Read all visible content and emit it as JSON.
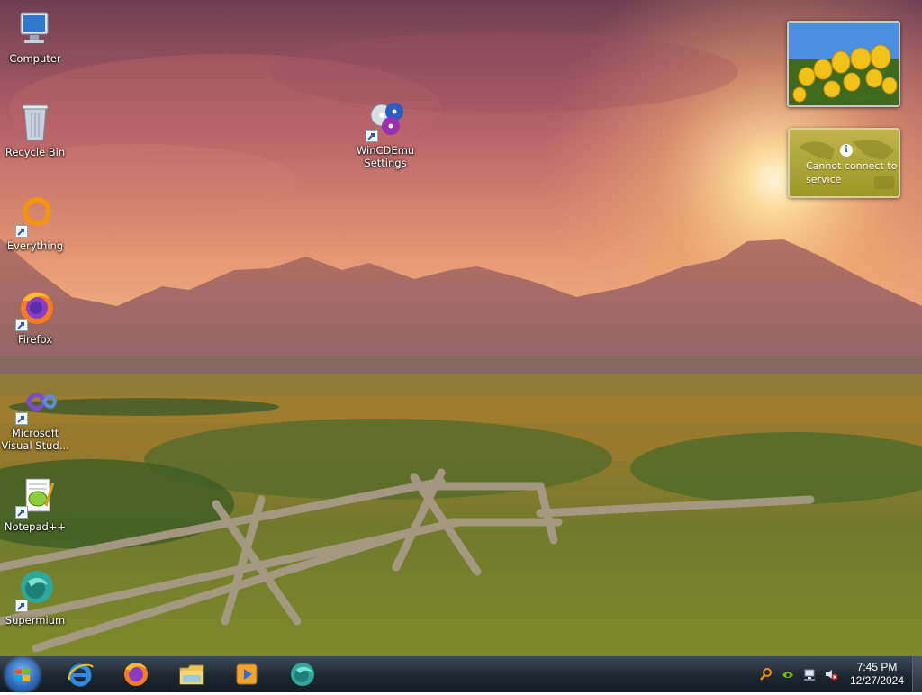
{
  "desktop": {
    "icons": [
      {
        "label": "Computer",
        "name": "computer"
      },
      {
        "label": "Recycle Bin",
        "name": "recycle-bin"
      },
      {
        "label": "Everything",
        "name": "everything"
      },
      {
        "label": "Firefox",
        "name": "firefox"
      },
      {
        "label": "Microsoft Visual Stud...",
        "name": "visual-studio"
      },
      {
        "label": "Notepad++",
        "name": "notepad-plus-plus"
      },
      {
        "label": "Supermium",
        "name": "supermium"
      },
      {
        "label": "WinCDEmu Settings",
        "name": "wincdemu-settings"
      }
    ]
  },
  "gadgets": {
    "weather_message": "Cannot connect to service",
    "info_glyph": "i"
  },
  "taskbar": {
    "pinned": [
      "internet-explorer",
      "firefox",
      "file-explorer",
      "media-player",
      "supermium"
    ],
    "clock": {
      "time": "7:45 PM",
      "date": "12/27/2024"
    }
  },
  "colors": {
    "sky_top": "#7a4a5a",
    "sun_glow": "#ffd98a",
    "mountains": "#a86a62",
    "meadow": "#8a7a2a",
    "taskbar": "#1d2731"
  }
}
